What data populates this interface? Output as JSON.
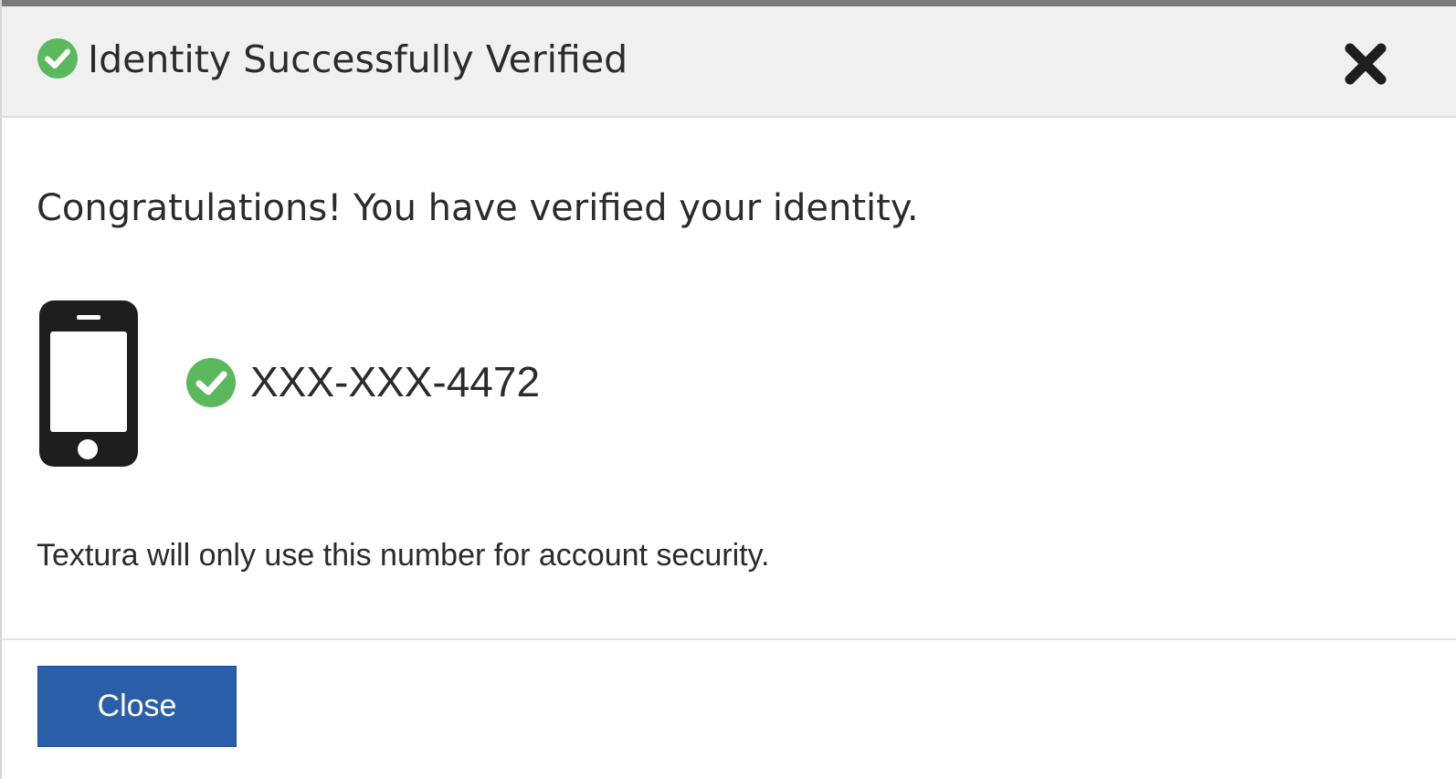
{
  "header": {
    "title": "Identity Successfully Verified",
    "status_icon": "check-circle-icon",
    "close_icon": "close-x-icon"
  },
  "body": {
    "congrats_text": "Congratulations! You have verified your identity.",
    "device_icon": "mobile-phone-icon",
    "verified_icon": "check-circle-icon",
    "phone_number": "XXX-XXX-4472",
    "security_note": "Textura will only use this number for account security."
  },
  "footer": {
    "close_label": "Close"
  },
  "colors": {
    "success_green": "#5cb85c",
    "primary_button": "#2a5ea8",
    "header_bg": "#f0f0f0",
    "text": "#2b2b2b"
  }
}
